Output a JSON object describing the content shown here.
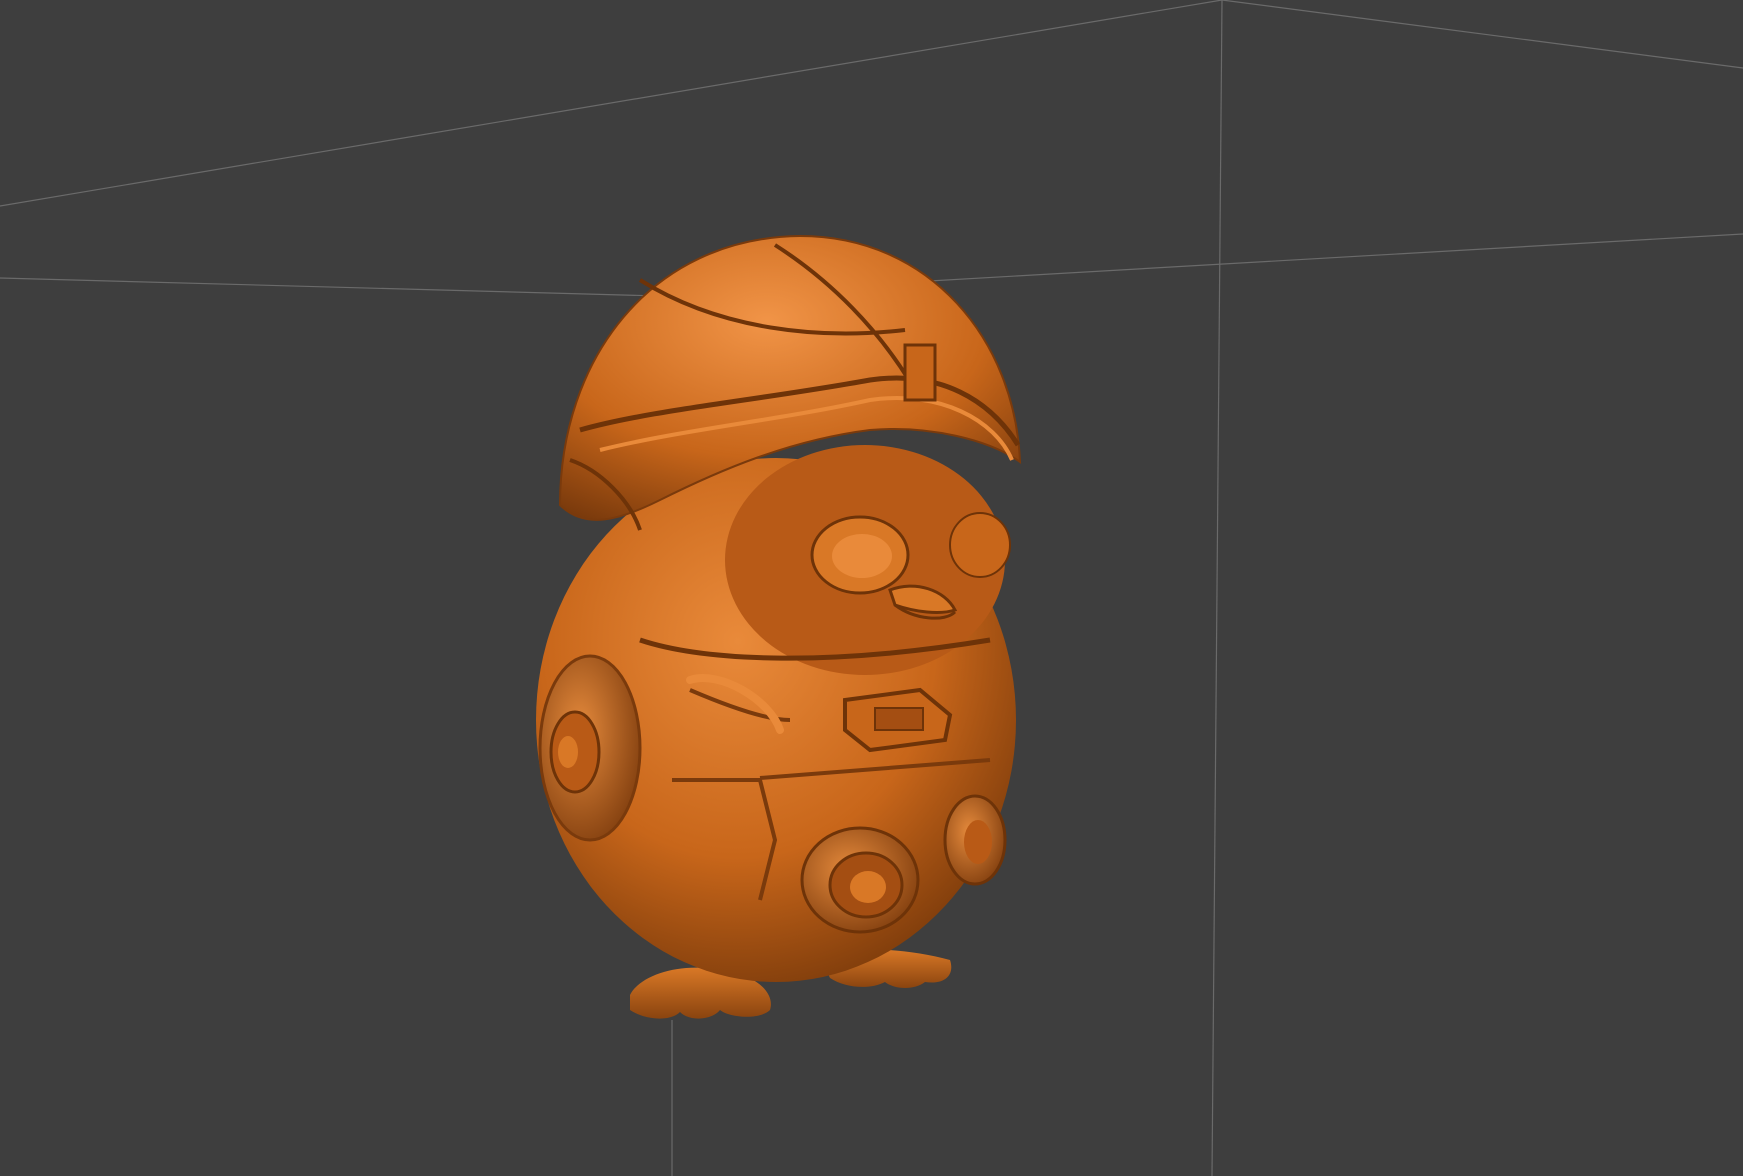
{
  "viewport": {
    "background_color": "#3e3e3e",
    "grid_line_color": "#6a6a6a",
    "model": {
      "description_icon": "3d-model-owl-astronaut",
      "material_color": "#c8661a",
      "highlight_color": "#e98a3a",
      "shadow_color": "#6e3308"
    }
  }
}
